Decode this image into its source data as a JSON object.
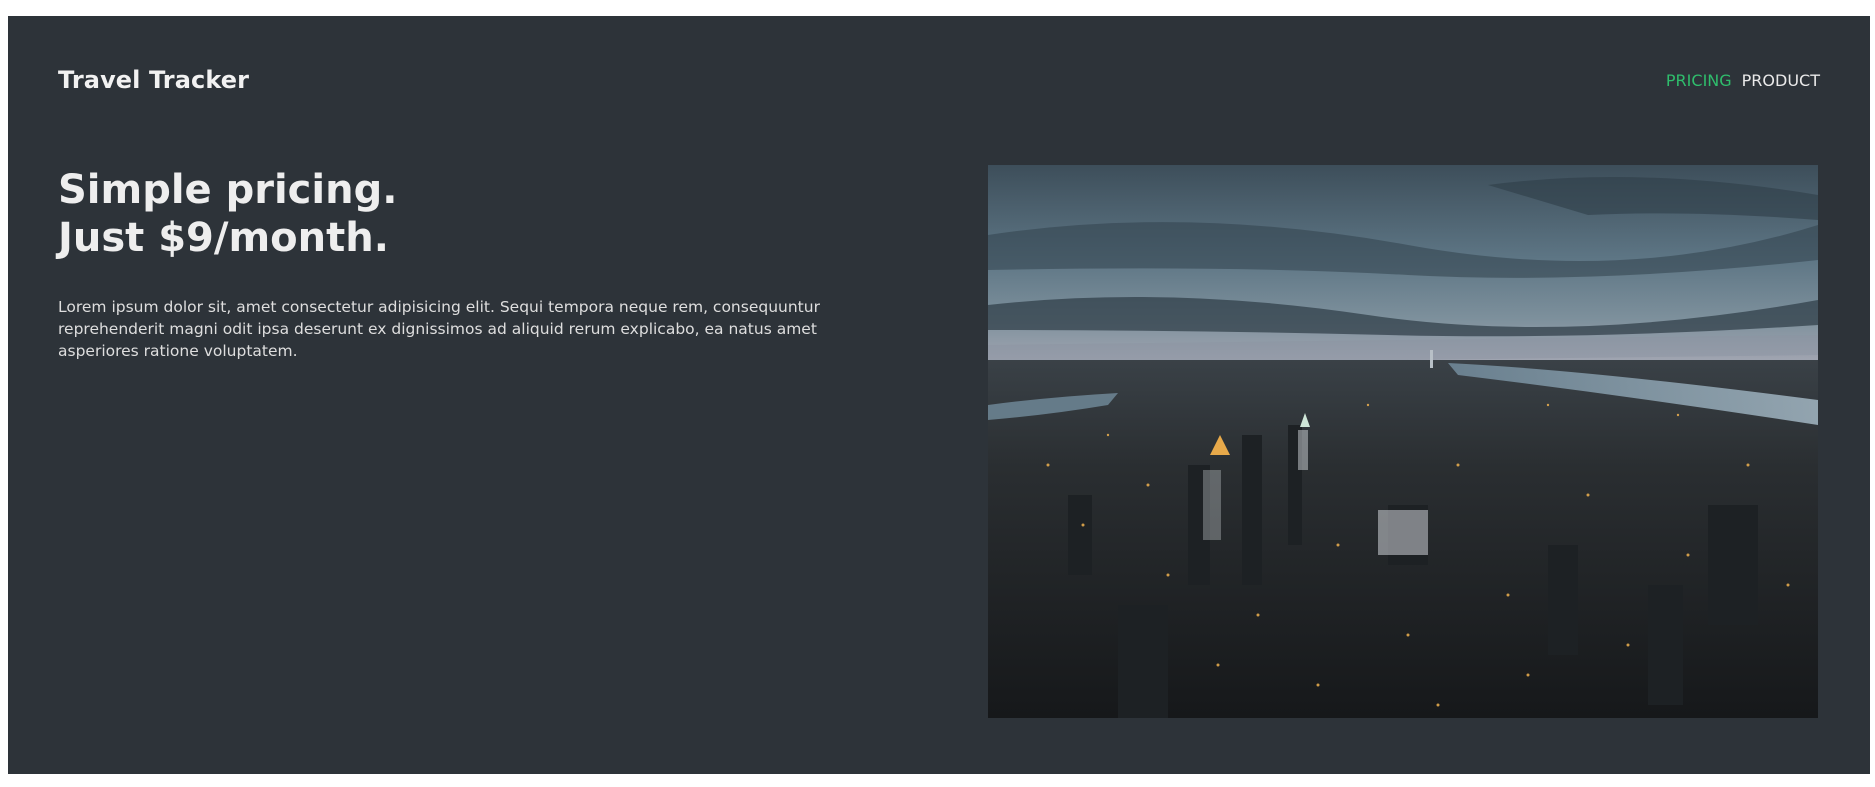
{
  "header": {
    "logo_text": "Travel Tracker",
    "nav": [
      {
        "label": "PRICING",
        "active": true
      },
      {
        "label": "PRODUCT",
        "active": false
      }
    ]
  },
  "hero": {
    "headline_line1": "Simple pricing.",
    "headline_line2": "Just $9/month.",
    "description": "Lorem ipsum dolor sit, amet consectetur adipisicing elit. Sequi tempora neque rem, consequuntur reprehenderit magni odit ipsa deserunt ex dignissimos ad aliquid rerum explicabo, ea natus amet asperiores ratione voluptatem."
  },
  "image": {
    "alt": "Aerial view of a city at dusk"
  },
  "colors": {
    "background": "#2d3339",
    "accent": "#2fbd6c",
    "text": "#e8e8e8"
  }
}
